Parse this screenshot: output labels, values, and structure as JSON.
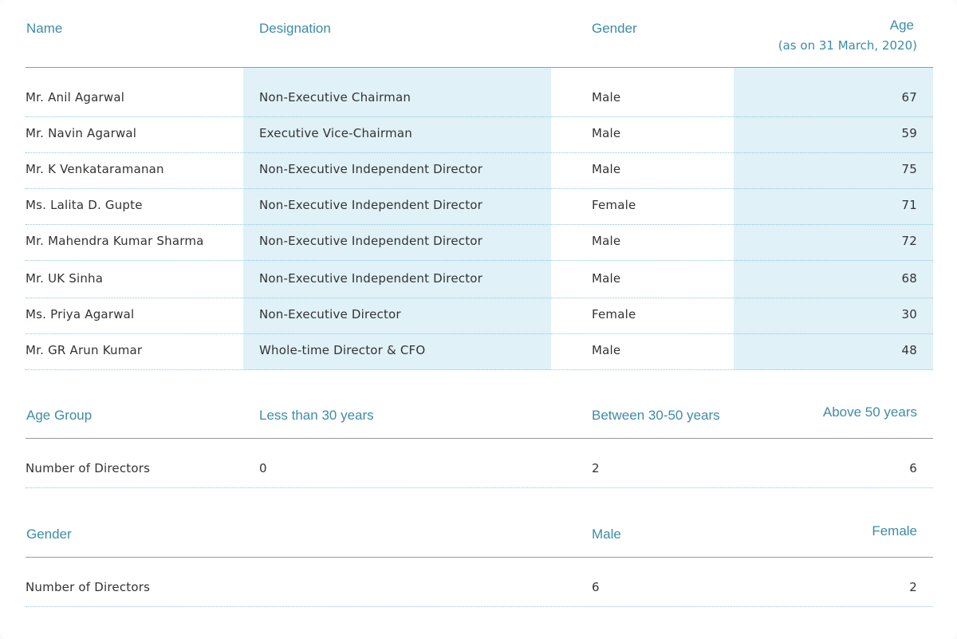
{
  "directors_table": {
    "headers": {
      "name": "Name",
      "designation": "Designation",
      "gender": "Gender",
      "age": "Age",
      "age_note": "(as on 31 March, 2020)"
    },
    "rows": [
      {
        "name": "Mr. Anil Agarwal",
        "designation": "Non-Executive Chairman",
        "gender": "Male",
        "age": "67"
      },
      {
        "name": "Mr. Navin Agarwal",
        "designation": "Executive Vice-Chairman",
        "gender": "Male",
        "age": "59"
      },
      {
        "name": "Mr. K Venkataramanan",
        "designation": "Non-Executive Independent Director",
        "gender": "Male",
        "age": "75"
      },
      {
        "name": "Ms. Lalita D. Gupte",
        "designation": "Non-Executive Independent Director",
        "gender": "Female",
        "age": "71"
      },
      {
        "name": "Mr. Mahendra Kumar Sharma",
        "designation": "Non-Executive Independent Director",
        "gender": "Male",
        "age": "72"
      },
      {
        "name": "Mr. UK Sinha",
        "designation": "Non-Executive Independent Director",
        "gender": "Male",
        "age": "68"
      },
      {
        "name": "Ms. Priya Agarwal",
        "designation": "Non-Executive Director",
        "gender": "Female",
        "age": "30"
      },
      {
        "name": "Mr. GR Arun Kumar",
        "designation": "Whole-time Director & CFO",
        "gender": "Male",
        "age": "48"
      }
    ]
  },
  "age_group_table": {
    "headers": {
      "label": "Age Group",
      "col1": "Less than 30 years",
      "col2": "Between 30-50 years",
      "col3": "Above 50 years"
    },
    "row": {
      "label": "Number of Directors",
      "col1": "0",
      "col2": "2",
      "col3": "6"
    }
  },
  "gender_table": {
    "headers": {
      "label": "Gender",
      "male": "Male",
      "female": "Female"
    },
    "row": {
      "label": "Number of Directors",
      "male": "6",
      "female": "2"
    }
  },
  "colors": {
    "header_text": "#3d8ca6",
    "shade": "#e0f1f8",
    "dotted_rule": "#8ec9dd"
  }
}
